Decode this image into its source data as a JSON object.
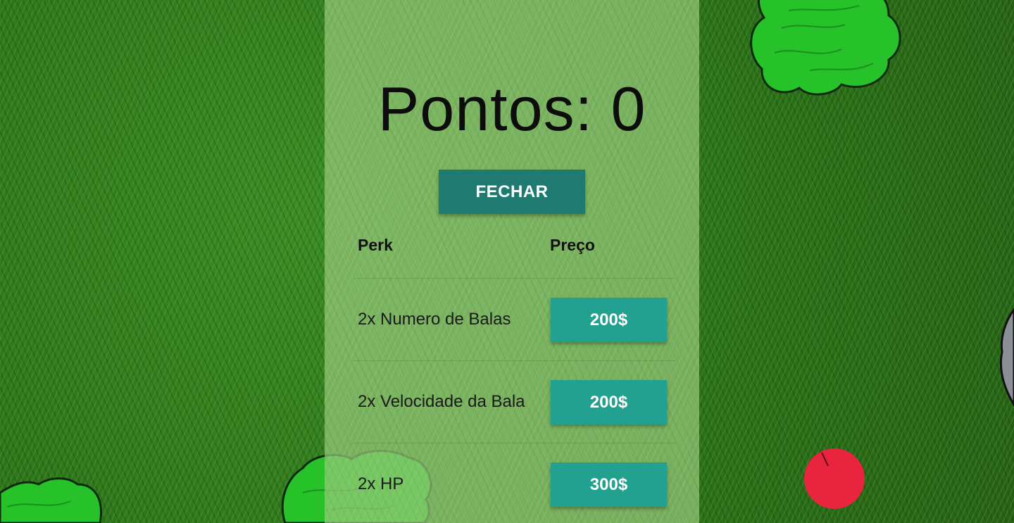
{
  "shop": {
    "score_label": "Pontos: 0",
    "close_label": "FECHAR",
    "columns": {
      "perk": "Perk",
      "price": "Preço"
    },
    "perks": [
      {
        "name": "2x Numero de Balas",
        "price": "200$"
      },
      {
        "name": "2x Velocidade da Bala",
        "price": "200$"
      },
      {
        "name": "2x HP",
        "price": "300$"
      }
    ]
  },
  "colors": {
    "close_button": "#1f7a71",
    "buy_button": "#22a090",
    "bush": "#27c22a",
    "player": "#e8243f",
    "rock": "#8a8f96"
  }
}
